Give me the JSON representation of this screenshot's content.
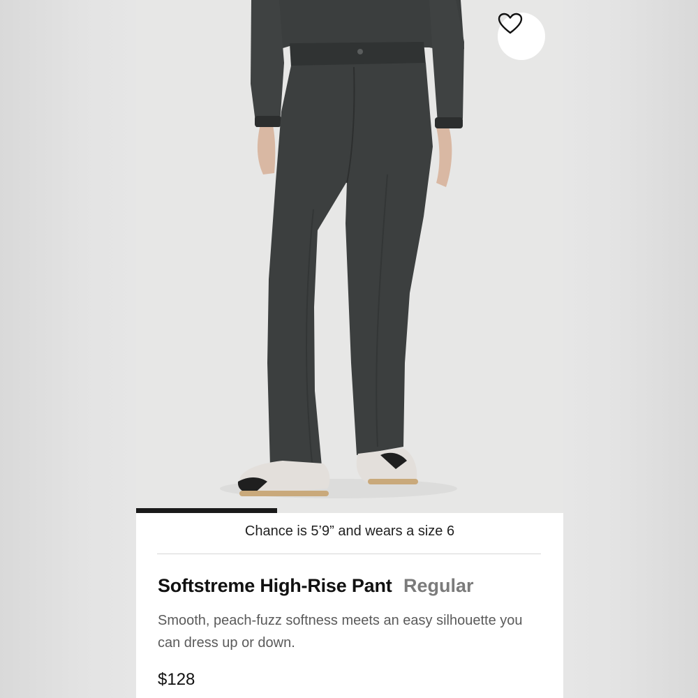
{
  "product": {
    "image_alt_icon": "product-photo",
    "carousel_progress": 0.33,
    "model_caption": "Chance is 5’9” and wears a size 6",
    "name": "Softstreme High-Rise Pant",
    "fit": "Regular",
    "description": "Smooth, peach-fuzz softness meets an easy silhouette you can dress up or down.",
    "price": "$128",
    "wishlist_icon": "heart-icon"
  },
  "colors": {
    "garment": "#3c3f3f",
    "background": "#e7e7e6",
    "text_primary": "#111111",
    "text_secondary": "#7b7b7b"
  }
}
